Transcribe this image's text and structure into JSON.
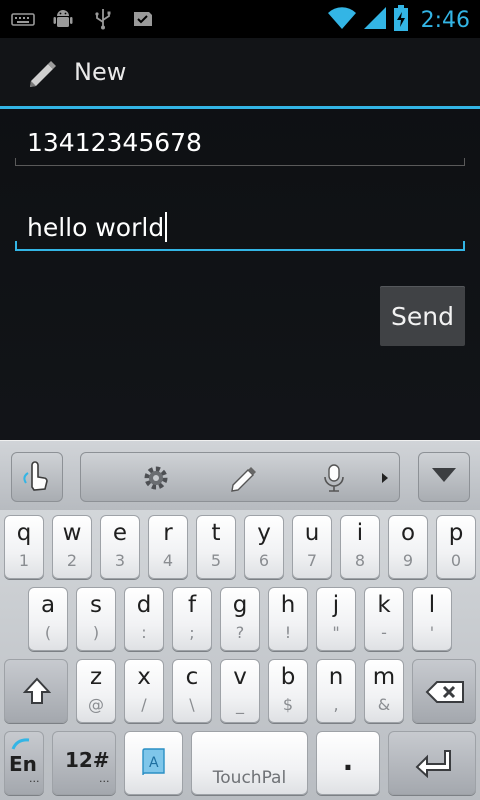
{
  "status_bar": {
    "icons_left": [
      "keyboard-icon",
      "android-debug-icon",
      "usb-icon",
      "sms-icon"
    ],
    "icons_right": [
      "wifi-icon",
      "signal-icon",
      "battery-icon"
    ],
    "time": "2:46"
  },
  "action_bar": {
    "title": "New",
    "icon": "pencil-icon"
  },
  "compose": {
    "recipient_value": "13412345678",
    "message_value": "hello world",
    "send_label": "Send"
  },
  "colors": {
    "accent": "#33b5e5",
    "background": "#101215",
    "send_button": "#404245"
  },
  "keyboard": {
    "toolbar_icons": [
      "handwriting-icon",
      "settings-icon",
      "pencil-icon",
      "microphone-icon",
      "more-arrow-icon",
      "hide-keyboard-icon"
    ],
    "row1": [
      {
        "main": "q",
        "sub": "1"
      },
      {
        "main": "w",
        "sub": "2"
      },
      {
        "main": "e",
        "sub": "3"
      },
      {
        "main": "r",
        "sub": "4"
      },
      {
        "main": "t",
        "sub": "5"
      },
      {
        "main": "y",
        "sub": "6"
      },
      {
        "main": "u",
        "sub": "7"
      },
      {
        "main": "i",
        "sub": "8"
      },
      {
        "main": "o",
        "sub": "9"
      },
      {
        "main": "p",
        "sub": "0"
      }
    ],
    "row2": [
      {
        "main": "a",
        "sub": "("
      },
      {
        "main": "s",
        "sub": ")"
      },
      {
        "main": "d",
        "sub": ":"
      },
      {
        "main": "f",
        "sub": ";"
      },
      {
        "main": "g",
        "sub": "?"
      },
      {
        "main": "h",
        "sub": "!"
      },
      {
        "main": "j",
        "sub": "\""
      },
      {
        "main": "k",
        "sub": "-"
      },
      {
        "main": "l",
        "sub": "'"
      }
    ],
    "row3": [
      {
        "main": "z",
        "sub": "@"
      },
      {
        "main": "x",
        "sub": "/"
      },
      {
        "main": "c",
        "sub": "\\"
      },
      {
        "main": "v",
        "sub": "_"
      },
      {
        "main": "b",
        "sub": "$"
      },
      {
        "main": "n",
        "sub": ","
      },
      {
        "main": "m",
        "sub": "&"
      }
    ],
    "lang_key": "En",
    "lang_key_dots": "...",
    "symbols_key": "12#",
    "symbols_key_dots": "...",
    "space_key": "TouchPal",
    "period_key": "."
  }
}
